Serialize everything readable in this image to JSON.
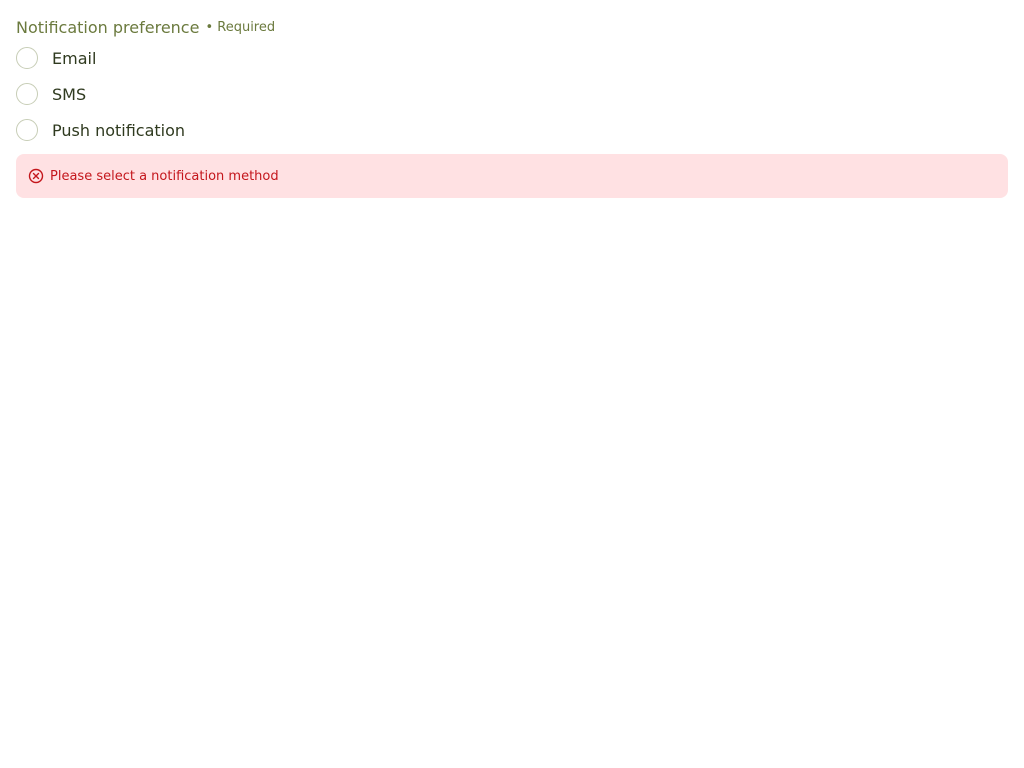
{
  "field": {
    "legend": "Notification preference",
    "required_label": "• Required"
  },
  "options": [
    {
      "label": "Email",
      "selected": false
    },
    {
      "label": "SMS",
      "selected": false
    },
    {
      "label": "Push notification",
      "selected": false
    }
  ],
  "error": {
    "icon": "error-circle-icon",
    "message": "Please select a notification method",
    "color": "#c4161c",
    "background": "#ffe1e3"
  },
  "colors": {
    "legend": "#6b7a3e",
    "text": "#2f3a1f",
    "radio_border": "#c7cdb6"
  }
}
